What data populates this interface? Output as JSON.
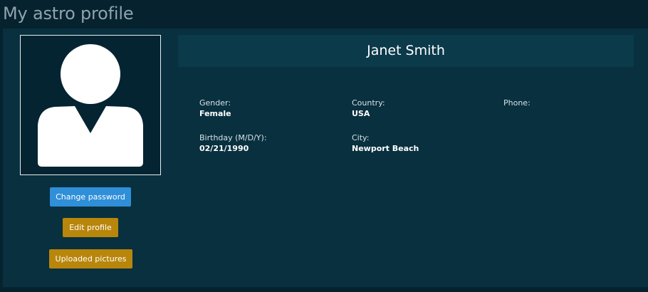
{
  "page": {
    "title": "My astro profile"
  },
  "profile": {
    "name": "Janet Smith",
    "fields": {
      "gender": {
        "label": "Gender:",
        "value": "Female"
      },
      "country": {
        "label": "Country:",
        "value": "USA"
      },
      "phone": {
        "label": "Phone:",
        "value": ""
      },
      "birthday": {
        "label": "Birthday (M/D/Y):",
        "value": "02/21/1990"
      },
      "city": {
        "label": "City:",
        "value": "Newport Beach"
      }
    }
  },
  "actions": {
    "change_password": "Change password",
    "edit_profile": "Edit profile",
    "uploaded_pictures": "Uploaded pictures"
  },
  "avatar": {
    "icon": "user-silhouette-icon"
  },
  "colors": {
    "background": "#06222f",
    "panel": "#08303f",
    "name_bar": "#0b3a4a",
    "button_blue": "#2f8fd8",
    "button_gold": "#b8860b"
  }
}
